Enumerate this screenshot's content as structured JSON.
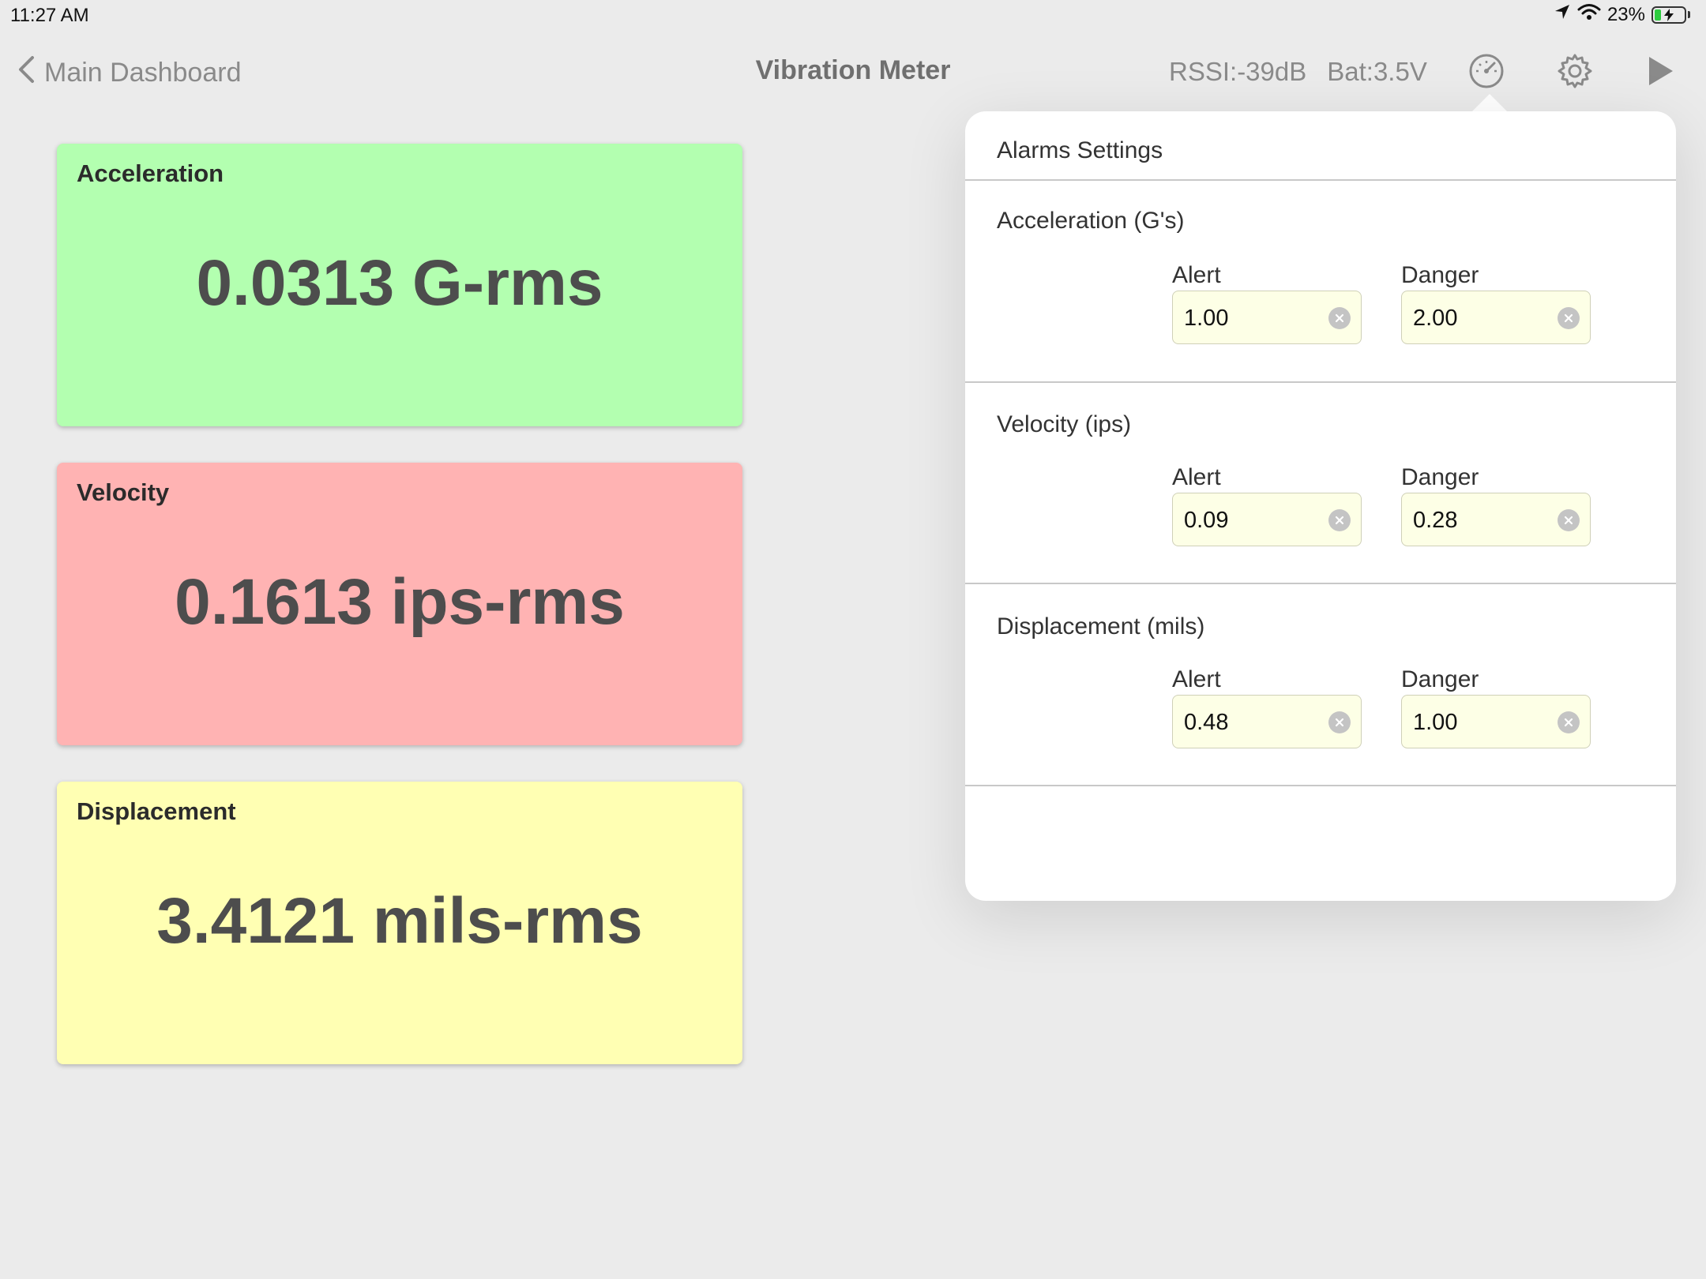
{
  "status_bar": {
    "time": "11:27 AM",
    "battery_percent": "23%",
    "battery_level": 0.23,
    "icons": [
      "location-arrow-icon",
      "wifi-icon",
      "battery-charging-icon"
    ]
  },
  "nav": {
    "back_label": "Main Dashboard",
    "title": "Vibration Meter",
    "rssi": "RSSI:-39dB",
    "battery": "Bat:3.5V",
    "icons": [
      "gauge-icon",
      "gear-icon",
      "play-icon"
    ]
  },
  "cards": [
    {
      "title": "Acceleration",
      "value": "0.0313 G-rms",
      "color": "#b3ffb0"
    },
    {
      "title": "Velocity",
      "value": "0.1613 ips-rms",
      "color": "#ffb3b3"
    },
    {
      "title": "Displacement",
      "value": "3.4121 mils-rms",
      "color": "#ffffb3"
    }
  ],
  "alarms": {
    "header": "Alarms Settings",
    "sections": [
      {
        "title": "Acceleration (G's)",
        "alert_label": "Alert",
        "alert_value": "1.00",
        "danger_label": "Danger",
        "danger_value": "2.00"
      },
      {
        "title": "Velocity (ips)",
        "alert_label": "Alert",
        "alert_value": "0.09",
        "danger_label": "Danger",
        "danger_value": "0.28"
      },
      {
        "title": "Displacement (mils)",
        "alert_label": "Alert",
        "alert_value": "0.48",
        "danger_label": "Danger",
        "danger_value": "1.00"
      }
    ]
  },
  "colors": {
    "background": "#ebebeb",
    "field_background": "#fdffe6",
    "accent_gray": "#8a8a8a"
  }
}
